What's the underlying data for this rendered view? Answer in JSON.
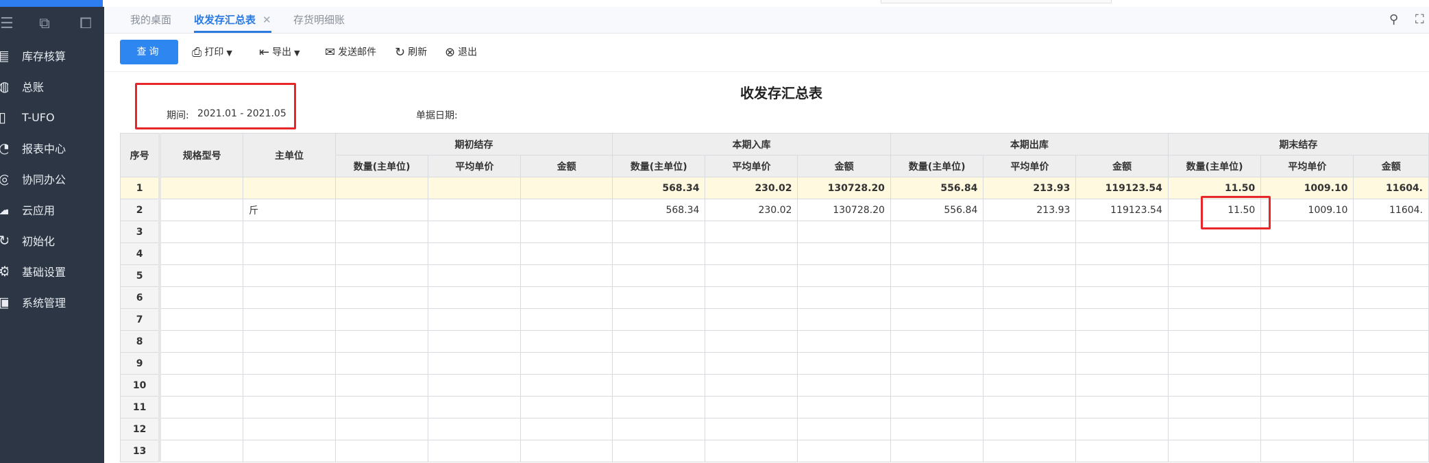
{
  "tabs": {
    "desk": "我的桌面",
    "summary": "收发存汇总表",
    "summary_close": "✕",
    "detail": "存货明细账"
  },
  "sidebar": {
    "items": [
      {
        "label": "库存核算",
        "icon": "inventory-icon"
      },
      {
        "label": "总账",
        "icon": "ledger-icon"
      },
      {
        "label": "T-UFO",
        "icon": "report-file-icon"
      },
      {
        "label": "报表中心",
        "icon": "report-center-icon"
      },
      {
        "label": "协同办公",
        "icon": "collaboration-icon"
      },
      {
        "label": "云应用",
        "icon": "cloud-icon"
      },
      {
        "label": "初始化",
        "icon": "refresh-init-icon"
      },
      {
        "label": "基础设置",
        "icon": "settings-icon"
      },
      {
        "label": "系统管理",
        "icon": "system-icon"
      }
    ]
  },
  "toolbar": {
    "query": "查询",
    "print": "打印",
    "export": "导出",
    "email": "发送邮件",
    "refresh": "刷新",
    "exit": "退出"
  },
  "report": {
    "title": "收发存汇总表",
    "period_label": "期间:",
    "period_value": "2021.01 - 2021.05",
    "doc_date_label": "单据日期:"
  },
  "table": {
    "headers": {
      "seq": "序号",
      "spec": "规格型号",
      "unit": "主单位",
      "opening": "期初结存",
      "inbound": "本期入库",
      "outbound": "本期出库",
      "closing": "期末结存",
      "qty": "数量(主单位)",
      "avg_price": "平均单价",
      "amount": "金额"
    },
    "rows": [
      {
        "seq": "1",
        "spec": "",
        "unit": "",
        "o_qty": "",
        "o_price": "",
        "o_amt": "",
        "i_qty": "568.34",
        "i_price": "230.02",
        "i_amt": "130728.20",
        "out_qty": "556.84",
        "out_price": "213.93",
        "out_amt": "119123.54",
        "c_qty": "11.50",
        "c_price": "1009.10",
        "c_amt": "11604."
      },
      {
        "seq": "2",
        "spec": "",
        "unit": "斤",
        "o_qty": "",
        "o_price": "",
        "o_amt": "",
        "i_qty": "568.34",
        "i_price": "230.02",
        "i_amt": "130728.20",
        "out_qty": "556.84",
        "out_price": "213.93",
        "out_amt": "119123.54",
        "c_qty": "11.50",
        "c_price": "1009.10",
        "c_amt": "11604."
      },
      {
        "seq": "3"
      },
      {
        "seq": "4"
      },
      {
        "seq": "5"
      },
      {
        "seq": "6"
      },
      {
        "seq": "7"
      },
      {
        "seq": "8"
      },
      {
        "seq": "9"
      },
      {
        "seq": "10"
      },
      {
        "seq": "11"
      },
      {
        "seq": "12"
      },
      {
        "seq": "13"
      }
    ]
  }
}
